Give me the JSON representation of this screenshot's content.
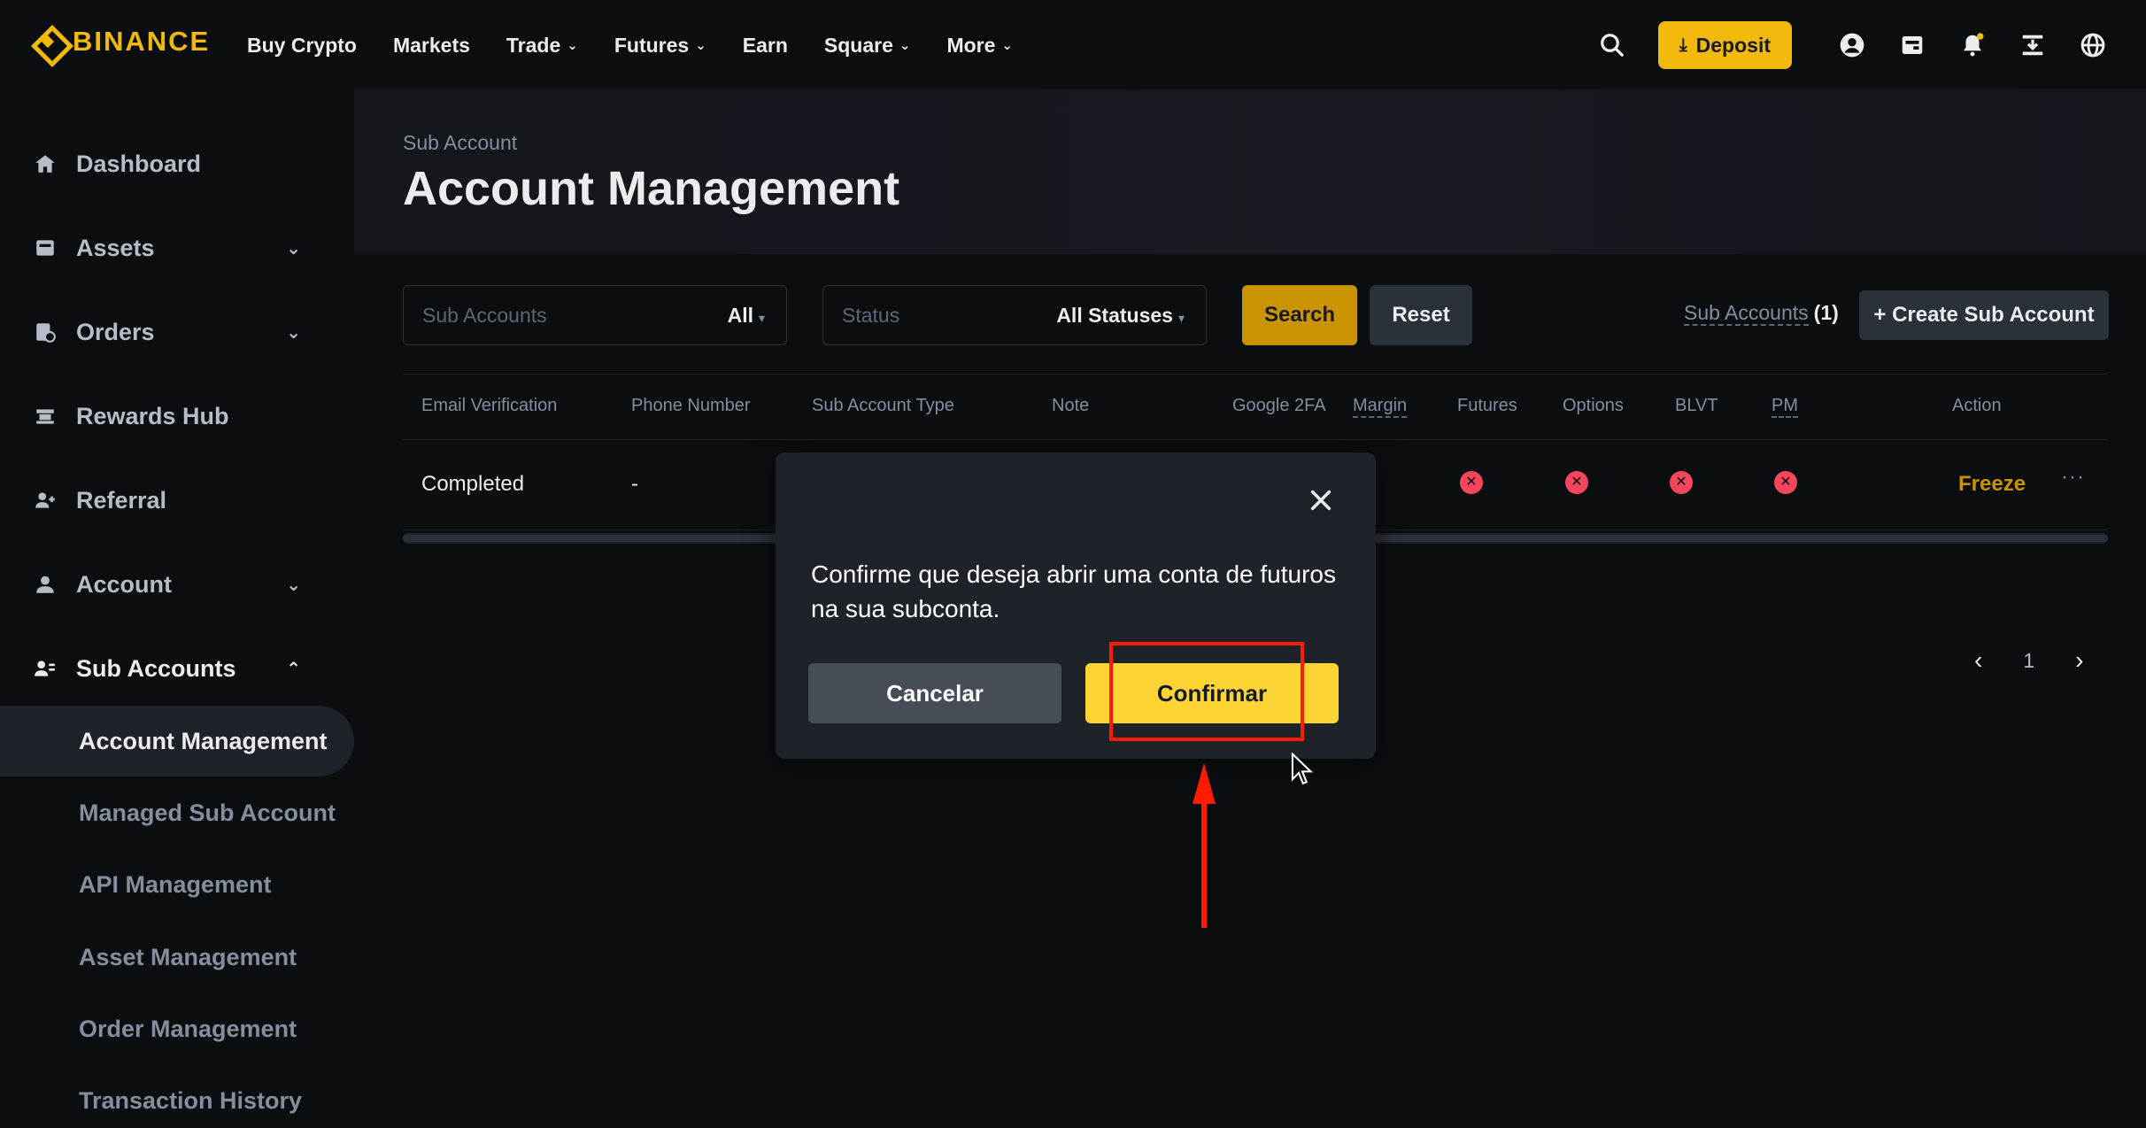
{
  "brand": {
    "name": "BINANCE",
    "accent": "#f0b90b"
  },
  "nav": {
    "items": [
      {
        "label": "Buy Crypto",
        "dropdown": false
      },
      {
        "label": "Markets",
        "dropdown": false
      },
      {
        "label": "Trade",
        "dropdown": true
      },
      {
        "label": "Futures",
        "dropdown": true
      },
      {
        "label": "Earn",
        "dropdown": false
      },
      {
        "label": "Square",
        "dropdown": true
      },
      {
        "label": "More",
        "dropdown": true
      }
    ],
    "deposit_label": "Deposit",
    "right_icons": [
      "search-icon",
      "profile-icon",
      "wallet-icon",
      "bell-icon",
      "download-icon",
      "globe-icon"
    ]
  },
  "sidebar": {
    "items": [
      {
        "label": "Dashboard",
        "icon": "home-icon",
        "chevron": ""
      },
      {
        "label": "Assets",
        "icon": "wallet-icon",
        "chevron": "down"
      },
      {
        "label": "Orders",
        "icon": "orders-icon",
        "chevron": "down"
      },
      {
        "label": "Rewards Hub",
        "icon": "rewards-icon",
        "chevron": ""
      },
      {
        "label": "Referral",
        "icon": "referral-icon",
        "chevron": ""
      },
      {
        "label": "Account",
        "icon": "user-icon",
        "chevron": "down"
      },
      {
        "label": "Sub Accounts",
        "icon": "sub-accounts-icon",
        "chevron": "up"
      }
    ],
    "sub_items": [
      {
        "label": "Account Management",
        "active": true
      },
      {
        "label": "Managed Sub Account",
        "active": false
      },
      {
        "label": "API Management",
        "active": false
      },
      {
        "label": "Asset Management",
        "active": false
      },
      {
        "label": "Order Management",
        "active": false
      },
      {
        "label": "Transaction History",
        "active": false
      }
    ]
  },
  "main": {
    "breadcrumb": "Sub Account",
    "title": "Account Management",
    "filters": {
      "sub_accounts": {
        "placeholder": "Sub Accounts",
        "value": "All"
      },
      "status": {
        "placeholder": "Status",
        "value": "All Statuses"
      }
    },
    "search_label": "Search",
    "reset_label": "Reset",
    "sub_accounts_count_label": "Sub Accounts",
    "sub_accounts_count": "(1)",
    "create_label": "+ Create Sub Account",
    "table": {
      "columns": [
        "Email Verification",
        "Phone Number",
        "Sub Account Type",
        "Note",
        "Google 2FA",
        "Margin",
        "Futures",
        "Options",
        "BLVT",
        "PM",
        "Action"
      ],
      "rows": [
        {
          "email_verification": "Completed",
          "phone_number": "-",
          "futures": "disabled",
          "options": "disabled",
          "blvt": "disabled",
          "pm": "disabled",
          "action": "Freeze",
          "more": "···"
        }
      ]
    },
    "pagination": {
      "current_page": "1"
    }
  },
  "modal": {
    "message": "Confirme que deseja abrir uma conta de futuros na sua subconta.",
    "cancel_label": "Cancelar",
    "confirm_label": "Confirmar"
  },
  "colors": {
    "background": "#0b0e11",
    "panel": "#1e2329",
    "annotation": "#ff1a00",
    "error": "#f6465d"
  }
}
